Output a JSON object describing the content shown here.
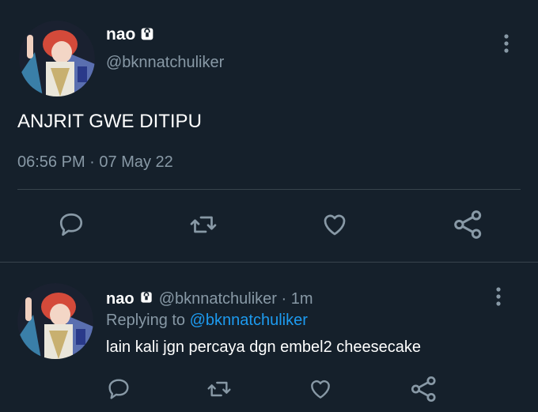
{
  "colors": {
    "background": "#15202b",
    "text_primary": "#ffffff",
    "text_secondary": "#8899a6",
    "link": "#1d9bf0",
    "divider": "#38444d",
    "icon": "#8899a6"
  },
  "main_tweet": {
    "display_name": "nao",
    "handle": "@bknnatchuliker",
    "text": "ANJRIT GWE DITIPU",
    "time": "06:56 PM",
    "separator": "·",
    "date": "07 May 22",
    "icons": {
      "lock": "lock-icon",
      "more": "more-vertical-icon",
      "reply": "reply-icon",
      "retweet": "retweet-icon",
      "like": "heart-icon",
      "share": "share-icon"
    }
  },
  "reply_tweet": {
    "display_name": "nao",
    "handle": "@bknnatchuliker",
    "separator": "·",
    "age": "1m",
    "replying_to_label": "Replying to",
    "replying_to_handle": "@bknnatchuliker",
    "text": "lain kali jgn percaya dgn embel2 cheesecake"
  }
}
